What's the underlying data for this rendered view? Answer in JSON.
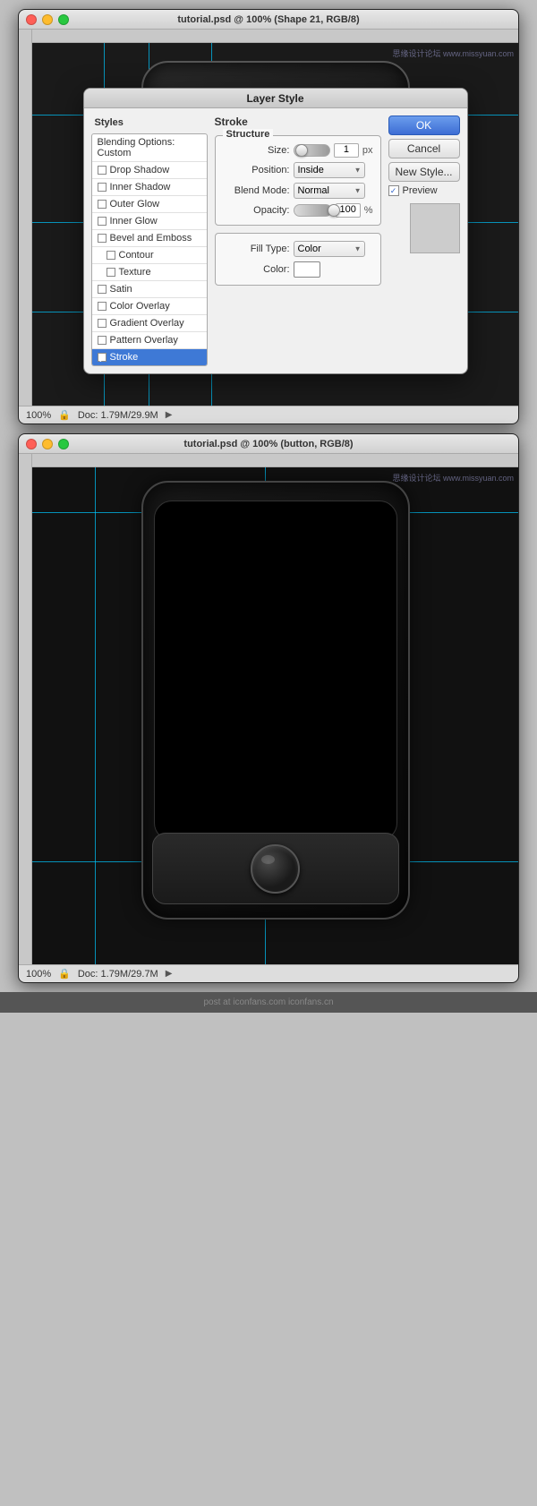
{
  "window1": {
    "title": "tutorial.psd @ 100% (Shape 21, RGB/8)",
    "status": {
      "zoom": "100%",
      "doc": "Doc: 1.79M/29.9M"
    }
  },
  "window2": {
    "title": "tutorial.psd @ 100% (button, RGB/8)",
    "status": {
      "zoom": "100%",
      "doc": "Doc: 1.79M/29.7M"
    }
  },
  "watermark": "思缘设计论坛 www.missyuan.com",
  "dialog": {
    "title": "Layer Style",
    "stroke_section": "Stroke",
    "structure_section": "Structure",
    "size_label": "Size:",
    "size_value": "1",
    "size_unit": "px",
    "position_label": "Position:",
    "position_value": "Inside",
    "blend_mode_label": "Blend Mode:",
    "blend_mode_value": "Normal",
    "opacity_label": "Opacity:",
    "opacity_value": "100",
    "opacity_unit": "%",
    "fill_type_label": "Fill Type:",
    "fill_type_value": "Color",
    "color_label": "Color:",
    "ok_btn": "OK",
    "cancel_btn": "Cancel",
    "new_style_btn": "New Style...",
    "preview_label": "Preview",
    "styles_header": "Styles",
    "style_items": [
      {
        "label": "Blending Options: Custom",
        "checked": false,
        "active": false,
        "indented": false
      },
      {
        "label": "Drop Shadow",
        "checked": false,
        "active": false,
        "indented": false
      },
      {
        "label": "Inner Shadow",
        "checked": false,
        "active": false,
        "indented": false
      },
      {
        "label": "Outer Glow",
        "checked": false,
        "active": false,
        "indented": false
      },
      {
        "label": "Inner Glow",
        "checked": false,
        "active": false,
        "indented": false
      },
      {
        "label": "Bevel and Emboss",
        "checked": false,
        "active": false,
        "indented": false
      },
      {
        "label": "Contour",
        "checked": false,
        "active": false,
        "indented": true
      },
      {
        "label": "Texture",
        "checked": false,
        "active": false,
        "indented": true
      },
      {
        "label": "Satin",
        "checked": false,
        "active": false,
        "indented": false
      },
      {
        "label": "Color Overlay",
        "checked": false,
        "active": false,
        "indented": false
      },
      {
        "label": "Gradient Overlay",
        "checked": false,
        "active": false,
        "indented": false
      },
      {
        "label": "Pattern Overlay",
        "checked": false,
        "active": false,
        "indented": false
      },
      {
        "label": "Stroke",
        "checked": true,
        "active": true,
        "indented": false
      }
    ]
  },
  "bottom_credit": "post at iconfans.com iconfans.cn"
}
